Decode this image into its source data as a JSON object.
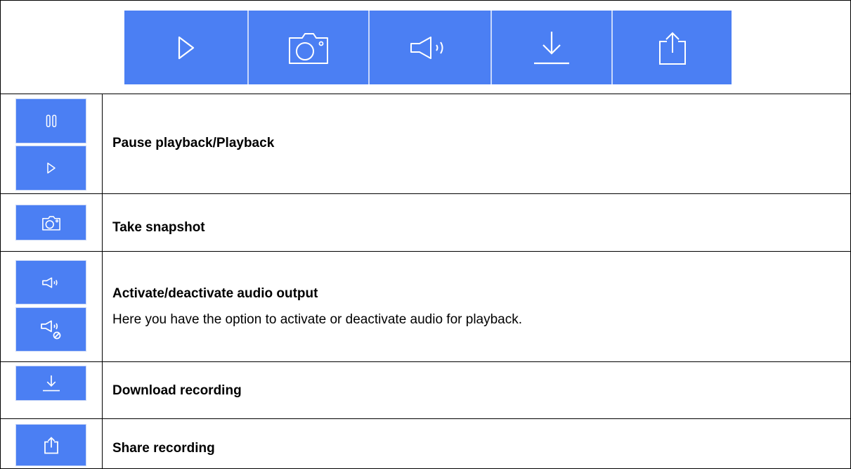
{
  "toolbar": {
    "buttons": [
      {
        "icon": "play-icon"
      },
      {
        "icon": "camera-icon"
      },
      {
        "icon": "speaker-icon"
      },
      {
        "icon": "download-icon"
      },
      {
        "icon": "share-icon"
      }
    ]
  },
  "rows": [
    {
      "icons": [
        "pause-icon",
        "play-icon"
      ],
      "label": "Pause playback/Playback",
      "description": ""
    },
    {
      "icons": [
        "camera-icon"
      ],
      "label": "Take snapshot",
      "description": ""
    },
    {
      "icons": [
        "speaker-icon",
        "speaker-muted-icon"
      ],
      "label": "Activate/deactivate audio output",
      "description": "Here you have the option to activate or deactivate audio for playback."
    },
    {
      "icons": [
        "download-icon"
      ],
      "label": "Download recording",
      "description": ""
    },
    {
      "icons": [
        "share-icon"
      ],
      "label": "Share recording",
      "description": ""
    }
  ],
  "colors": {
    "button_blue": "#4b7ff3",
    "icon_white": "#ffffff",
    "border": "#000000"
  }
}
